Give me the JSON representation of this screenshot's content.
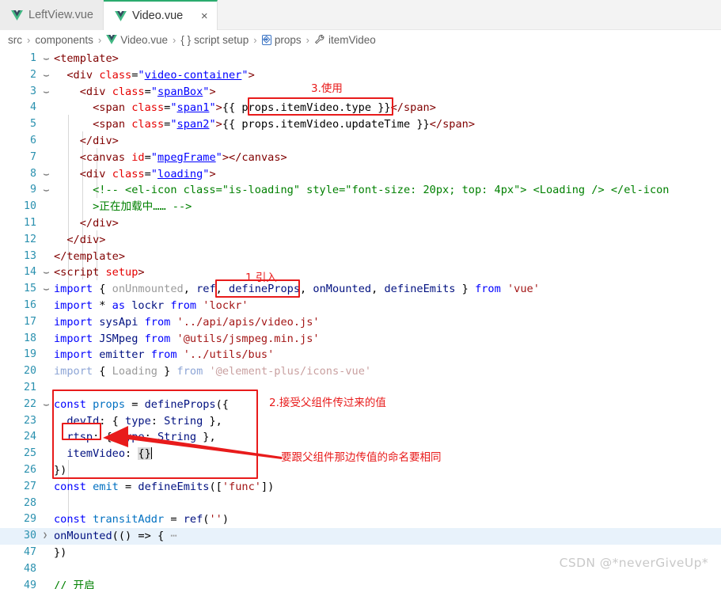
{
  "tabs": [
    {
      "label": "LeftView.vue",
      "icon": "vue-icon",
      "active": false,
      "closable": false
    },
    {
      "label": "Video.vue",
      "icon": "vue-icon",
      "active": true,
      "closable": true,
      "close_label": "×"
    }
  ],
  "breadcrumb": {
    "separator": "›",
    "items": [
      {
        "label": "src",
        "icon": ""
      },
      {
        "label": "components",
        "icon": ""
      },
      {
        "label": "Video.vue",
        "icon": "vue-icon"
      },
      {
        "label": "script setup",
        "icon": "braces-icon"
      },
      {
        "label": "props",
        "icon": "property-icon"
      },
      {
        "label": "itemVideo",
        "icon": "wrench-icon"
      }
    ]
  },
  "editor": {
    "lines": [
      {
        "n": "1",
        "fold": "v",
        "indent": 0
      },
      {
        "n": "2",
        "fold": "v",
        "indent": 1
      },
      {
        "n": "3",
        "fold": "v",
        "indent": 2
      },
      {
        "n": "4",
        "fold": "",
        "indent": 3
      },
      {
        "n": "5",
        "fold": "",
        "indent": 3
      },
      {
        "n": "6",
        "fold": "",
        "indent": 2
      },
      {
        "n": "7",
        "fold": "",
        "indent": 2
      },
      {
        "n": "8",
        "fold": "v",
        "indent": 2
      },
      {
        "n": "9",
        "fold": "v",
        "indent": 3
      },
      {
        "n": "10",
        "fold": "",
        "indent": 3
      },
      {
        "n": "11",
        "fold": "",
        "indent": 2
      },
      {
        "n": "12",
        "fold": "",
        "indent": 1
      },
      {
        "n": "13",
        "fold": "",
        "indent": 0
      },
      {
        "n": "14",
        "fold": "v",
        "indent": 0
      },
      {
        "n": "15",
        "fold": "v",
        "indent": 0
      },
      {
        "n": "16",
        "fold": "",
        "indent": 0
      },
      {
        "n": "17",
        "fold": "",
        "indent": 0
      },
      {
        "n": "18",
        "fold": "",
        "indent": 0
      },
      {
        "n": "19",
        "fold": "",
        "indent": 0
      },
      {
        "n": "20",
        "fold": "",
        "indent": 0
      },
      {
        "n": "21",
        "fold": "",
        "indent": 0
      },
      {
        "n": "22",
        "fold": "v",
        "indent": 0
      },
      {
        "n": "23",
        "fold": "",
        "indent": 1
      },
      {
        "n": "24",
        "fold": "",
        "indent": 1
      },
      {
        "n": "25",
        "fold": "",
        "indent": 1
      },
      {
        "n": "26",
        "fold": "",
        "indent": 0
      },
      {
        "n": "27",
        "fold": "",
        "indent": 0
      },
      {
        "n": "28",
        "fold": "",
        "indent": 0
      },
      {
        "n": "29",
        "fold": "",
        "indent": 0
      },
      {
        "n": "30",
        "fold": ">",
        "indent": 0,
        "highlight": true
      },
      {
        "n": "47",
        "fold": "",
        "indent": 0
      },
      {
        "n": "48",
        "fold": "",
        "indent": 0
      },
      {
        "n": "49",
        "fold": "",
        "indent": 0
      }
    ],
    "text": {
      "l1": "<template>",
      "l2": "  <div class=\"video-container\">",
      "l3": "    <div class=\"spanBox\">",
      "l4": "      <span class=\"span1\">{{ props.itemVideo.type }}</span>",
      "l5": "      <span class=\"span2\">{{ props.itemVideo.updateTime }}</span>",
      "l6": "    </div>",
      "l7": "    <canvas id=\"mpegFrame\"></canvas>",
      "l8": "    <div class=\"loading\">",
      "l9": "      <!-- <el-icon class=\"is-loading\" style=\"font-size: 20px; top: 4px\"> <Loading /> </el-icon",
      "l10": "      >正在加载中…… -->",
      "l11": "    </div>",
      "l12": "  </div>",
      "l13": "</template>",
      "l14": "<script setup>",
      "l15": "import { onUnmounted, ref, defineProps, onMounted, defineEmits } from 'vue'",
      "l16": "import * as lockr from 'lockr'",
      "l17": "import sysApi from '../api/apis/video.js'",
      "l18": "import JSMpeg from '@utils/jsmpeg.min.js'",
      "l19": "import emitter from '../utils/bus'",
      "l20": "import { Loading } from '@element-plus/icons-vue'",
      "l21": "",
      "l22": "const props = defineProps({",
      "l23": "  devId: { type: String },",
      "l24": "  rtsp: { type: String },",
      "l25": "  itemVideo: {}",
      "l26": "})",
      "l27": "const emit = defineEmits(['func'])",
      "l28": "",
      "l29": "const transitAddr = ref('')",
      "l30": "onMounted(() => { ⋯",
      "l47": "})",
      "l48": "",
      "l49": "// 开启"
    }
  },
  "annotations": {
    "color": "#e81b1b",
    "note1": "1.引入",
    "note2": "2.接受父组件传过来的值",
    "note3": "3.使用",
    "note4": "要跟父组件那边传值的命名要相同"
  },
  "watermark": "CSDN @*neverGiveUp*"
}
